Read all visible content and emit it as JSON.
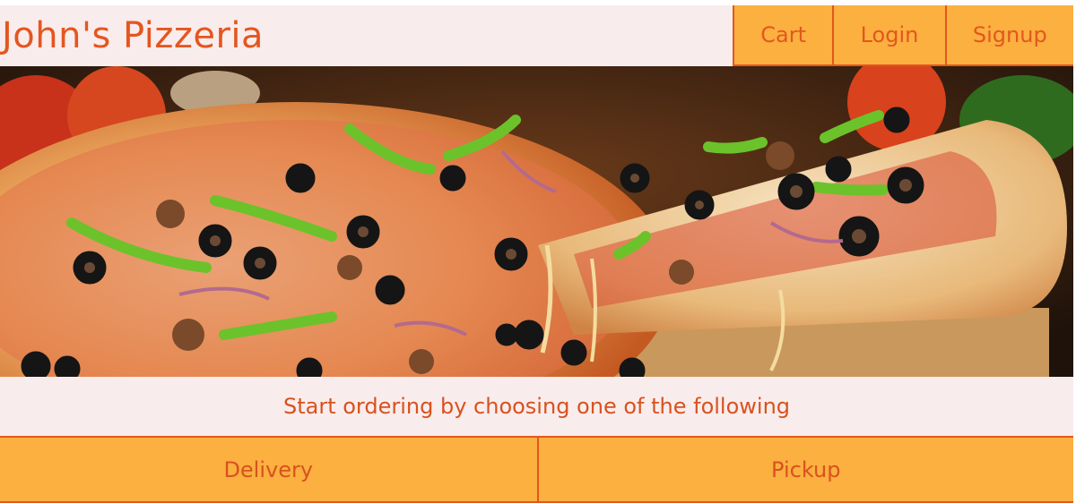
{
  "header": {
    "brand": "John's Pizzeria",
    "nav": [
      {
        "label": "Cart"
      },
      {
        "label": "Login"
      },
      {
        "label": "Signup"
      }
    ]
  },
  "hero": {
    "image": "pizza-photo"
  },
  "prompt": {
    "text": "Start ordering by choosing one of the following"
  },
  "options": [
    {
      "label": "Delivery"
    },
    {
      "label": "Pickup"
    }
  ],
  "colors": {
    "accent": "#fbb040",
    "brand_text": "#e4561f",
    "background": "#f9ecec"
  }
}
